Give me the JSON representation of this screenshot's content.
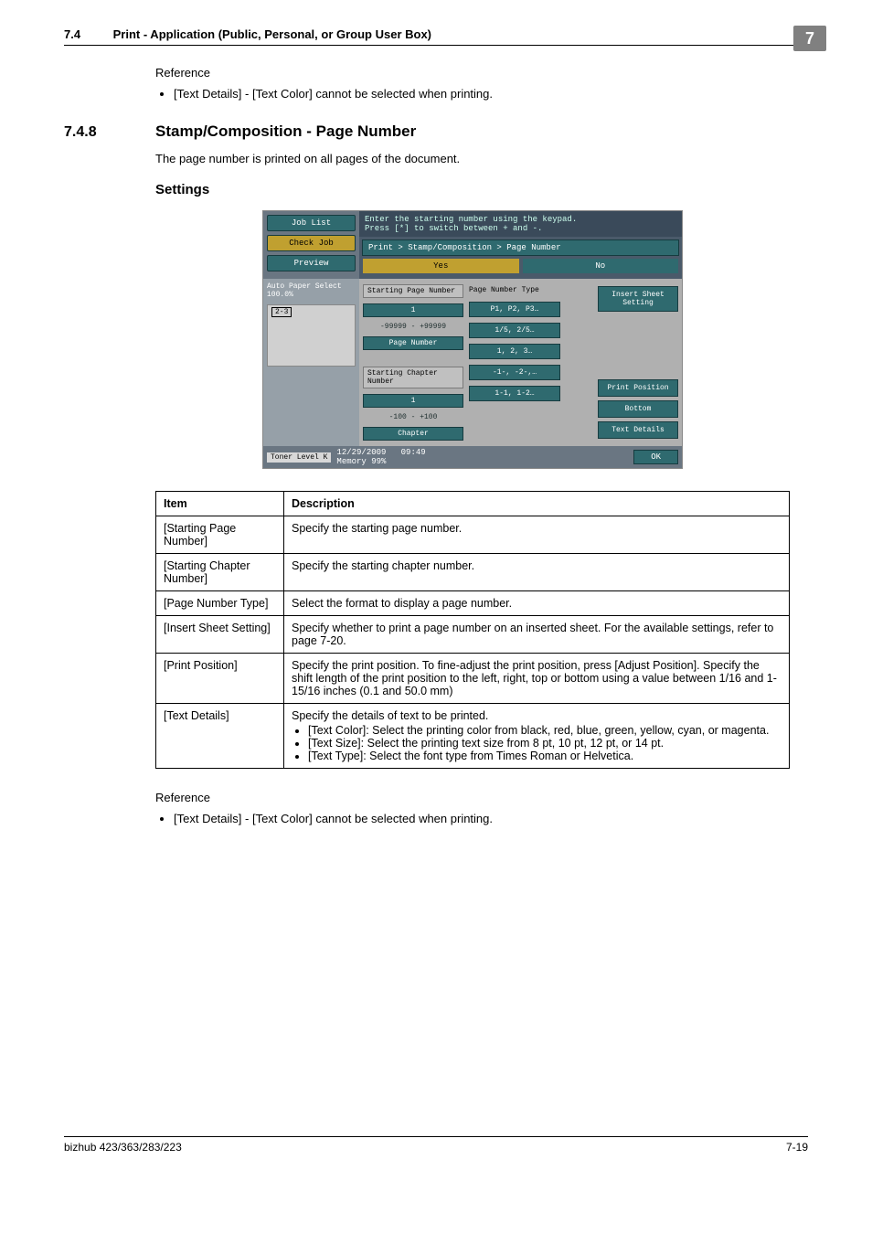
{
  "corner": "7",
  "header": {
    "num": "7.4",
    "title": "Print - Application (Public, Personal, or Group User Box)"
  },
  "ref_label": "Reference",
  "ref1_bullet": "[Text Details] - [Text Color] cannot be selected when printing.",
  "section": {
    "num": "7.4.8",
    "title": "Stamp/Composition - Page Number"
  },
  "section_intro": "The page number is printed on all pages of the document.",
  "settings_heading": "Settings",
  "shot": {
    "left_buttons": {
      "job_list": "Job List",
      "check_job": "Check Job",
      "preview": "Preview"
    },
    "instruction_line1": "Enter the starting number using the keypad.",
    "instruction_line2": "Press [*] to switch between + and -.",
    "crumb": "Print > Stamp/Composition > Page Number",
    "tab_yes": "Yes",
    "tab_no": "No",
    "autopaper": "Auto Paper Select   100.0%",
    "paper_preview": "2-3",
    "start_page_label": "Starting Page Number",
    "start_page_value": "1",
    "start_page_range": "-99999  -  +99999",
    "page_number_btn": "Page Number",
    "start_chapter_label": "Starting Chapter Number",
    "start_chapter_value": "1",
    "start_chapter_range": "-100  -  +100",
    "chapter_btn": "Chapter",
    "page_number_type_label": "Page Number Type",
    "types": [
      "P1, P2, P3…",
      "1/5, 2/5…",
      "1, 2, 3…",
      "-1-, -2-,…",
      "1-1, 1-2…"
    ],
    "side": {
      "insert_sheet": "Insert Sheet Setting",
      "print_position": "Print Position",
      "bottom": "Bottom",
      "text_details": "Text Details"
    },
    "toner": "Toner Level  K",
    "date": "12/29/2009",
    "time": "09:49",
    "memory": "Memory      99%",
    "ok": "OK"
  },
  "table": {
    "head_item": "Item",
    "head_desc": "Description",
    "rows": [
      {
        "item": "[Starting Page Number]",
        "desc": "Specify the starting page number."
      },
      {
        "item": "[Starting Chapter Number]",
        "desc": "Specify the starting chapter number."
      },
      {
        "item": "[Page Number Type]",
        "desc": "Select the format to display a page number."
      },
      {
        "item": "[Insert Sheet Setting]",
        "desc": "Specify whether to print a page number on an inserted sheet. For the available settings, refer to page 7-20."
      },
      {
        "item": "[Print Position]",
        "desc": "Specify the print position. To fine-adjust the print position, press [Adjust Position]. Specify the shift length of the print position to the left, right, top or bottom using a value between 1/16 and 1-15/16 inches (0.1 and 50.0 mm)"
      },
      {
        "item": "[Text Details]",
        "desc_intro": "Specify the details of text to be printed.",
        "bullets": [
          "[Text Color]: Select the printing color from black, red, blue, green, yellow, cyan, or magenta.",
          "[Text Size]: Select the printing text size from 8 pt, 10 pt, 12 pt, or 14 pt.",
          "[Text Type]: Select the font type from Times Roman or Helvetica."
        ]
      }
    ]
  },
  "ref2_bullet": "[Text Details] - [Text Color] cannot be selected when printing.",
  "footer": {
    "left": "bizhub 423/363/283/223",
    "right": "7-19"
  }
}
